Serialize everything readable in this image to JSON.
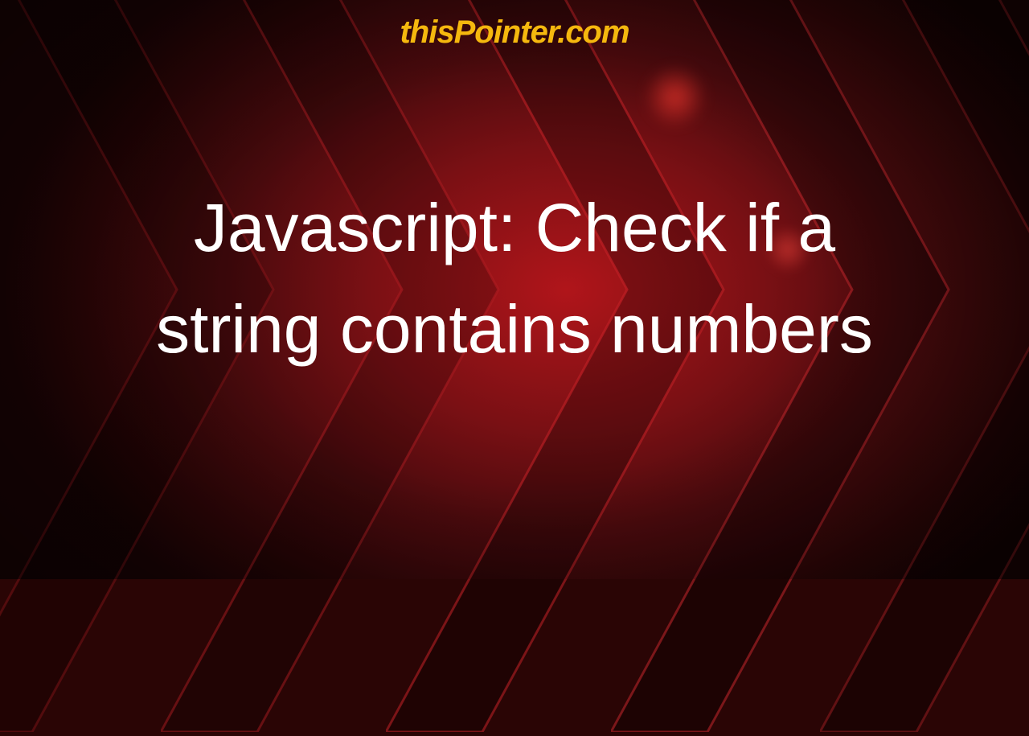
{
  "brand": "thisPointer.com",
  "title": "Javascript: Check if a string contains numbers",
  "colors": {
    "brand": "#f5b80e",
    "title": "#ffffff",
    "bg_dark": "#2a0506",
    "bg_accent": "#b0151a"
  }
}
